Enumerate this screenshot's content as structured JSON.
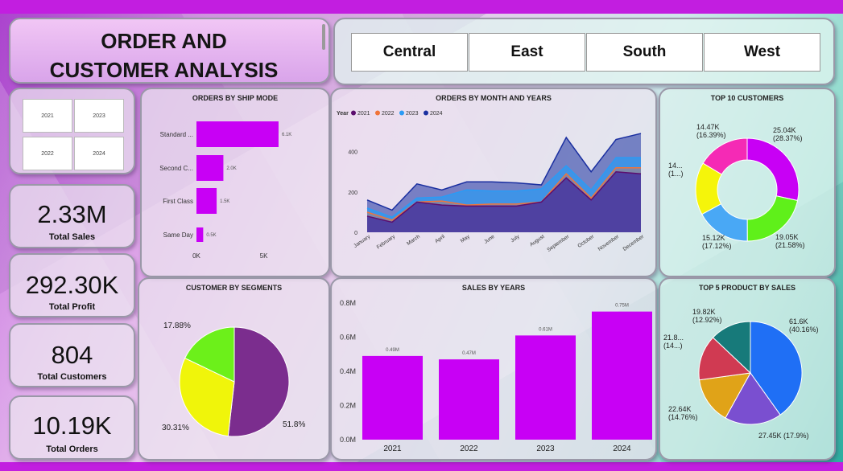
{
  "title_line1": "ORDER AND",
  "title_line2": "CUSTOMER ANALYSIS",
  "regions": [
    "Central",
    "East",
    "South",
    "West"
  ],
  "years": [
    "2021",
    "2023",
    "2022",
    "2024"
  ],
  "kpis": [
    {
      "value": "2.33M",
      "label": "Total Sales"
    },
    {
      "value": "292.30K",
      "label": "Total Profit"
    },
    {
      "value": "804",
      "label": "Total Customers"
    },
    {
      "value": "10.19K",
      "label": "Total Orders"
    }
  ],
  "colors": {
    "magenta": "#c800f5",
    "purple": "#7b2d8e",
    "y2021": "#5c0e6e",
    "y2022": "#f0743a",
    "y2023": "#2a9bf5",
    "y2024": "#1a2fa0"
  },
  "chart_data": [
    {
      "id": "ship_mode",
      "type": "bar",
      "title": "ORDERS BY SHIP MODE",
      "orientation": "horizontal",
      "categories": [
        "Standard ...",
        "Second C...",
        "First Class",
        "Same Day"
      ],
      "values": [
        6100,
        2000,
        1500,
        500
      ],
      "data_labels": [
        "6.1K",
        "2.0K",
        "1.5K",
        "0.5K"
      ],
      "xticks": [
        "0K",
        "5K"
      ],
      "xlim": [
        0,
        7000
      ]
    },
    {
      "id": "orders_month",
      "type": "area",
      "title": "ORDERS BY MONTH AND YEARS",
      "legend_title": "Year",
      "categories": [
        "January",
        "February",
        "March",
        "April",
        "May",
        "June",
        "July",
        "August",
        "September",
        "October",
        "November",
        "December"
      ],
      "yticks": [
        "0",
        "200",
        "400"
      ],
      "ylim": [
        0,
        550
      ],
      "series": [
        {
          "name": "2021",
          "values": [
            80,
            50,
            150,
            135,
            130,
            130,
            130,
            150,
            270,
            160,
            300,
            290
          ]
        },
        {
          "name": "2022",
          "values": [
            100,
            60,
            150,
            155,
            135,
            140,
            140,
            150,
            290,
            170,
            320,
            320
          ]
        },
        {
          "name": "2023",
          "values": [
            120,
            75,
            170,
            175,
            210,
            205,
            205,
            215,
            330,
            210,
            370,
            370
          ]
        },
        {
          "name": "2024",
          "values": [
            160,
            110,
            240,
            210,
            250,
            250,
            245,
            235,
            470,
            300,
            460,
            490
          ]
        }
      ]
    },
    {
      "id": "top10_customers",
      "type": "pie",
      "title": "TOP 10 CUSTOMERS",
      "donut": true,
      "labels": [
        "25.04K\n(28.37%)",
        "19.05K\n(21.58%)",
        "15.12K\n(17.12%)",
        "14...\n(1...)",
        "14.47K\n(16.39%)"
      ],
      "values": [
        28.37,
        21.58,
        17.12,
        16.54,
        16.39
      ],
      "colors": [
        "#c800f5",
        "#5ff01a",
        "#49a8f5",
        "#f5f50a",
        "#f52ab5"
      ]
    },
    {
      "id": "segments",
      "type": "pie",
      "title": "CUSTOMER BY SEGMENTS",
      "labels": [
        "51.8%",
        "30.31%",
        "17.88%"
      ],
      "values": [
        51.8,
        30.31,
        17.88
      ],
      "colors": [
        "#7b2d8e",
        "#f0f50a",
        "#6cf01a"
      ]
    },
    {
      "id": "sales_years",
      "type": "bar",
      "title": "SALES BY YEARS",
      "categories": [
        "2021",
        "2022",
        "2023",
        "2024"
      ],
      "values": [
        0.49,
        0.47,
        0.61,
        0.75
      ],
      "data_labels": [
        "0.49M",
        "0.47M",
        "0.61M",
        "0.75M"
      ],
      "yticks": [
        "0.0M",
        "0.2M",
        "0.4M",
        "0.6M",
        "0.8M"
      ],
      "ylim": [
        0,
        0.8
      ]
    },
    {
      "id": "top5_products",
      "type": "pie",
      "title": "TOP 5 PRODUCT BY SALES",
      "labels": [
        "61.6K\n(40.16%)",
        "27.45K (17.9%)",
        "22.64K\n(14.76%)",
        "21.8...\n(14...)",
        "19.82K\n(12.92%)"
      ],
      "values": [
        40.16,
        17.9,
        14.76,
        14.26,
        12.92
      ],
      "colors": [
        "#1f6ff5",
        "#7a4fd0",
        "#e0a318",
        "#d03a52",
        "#177a7a"
      ]
    }
  ]
}
